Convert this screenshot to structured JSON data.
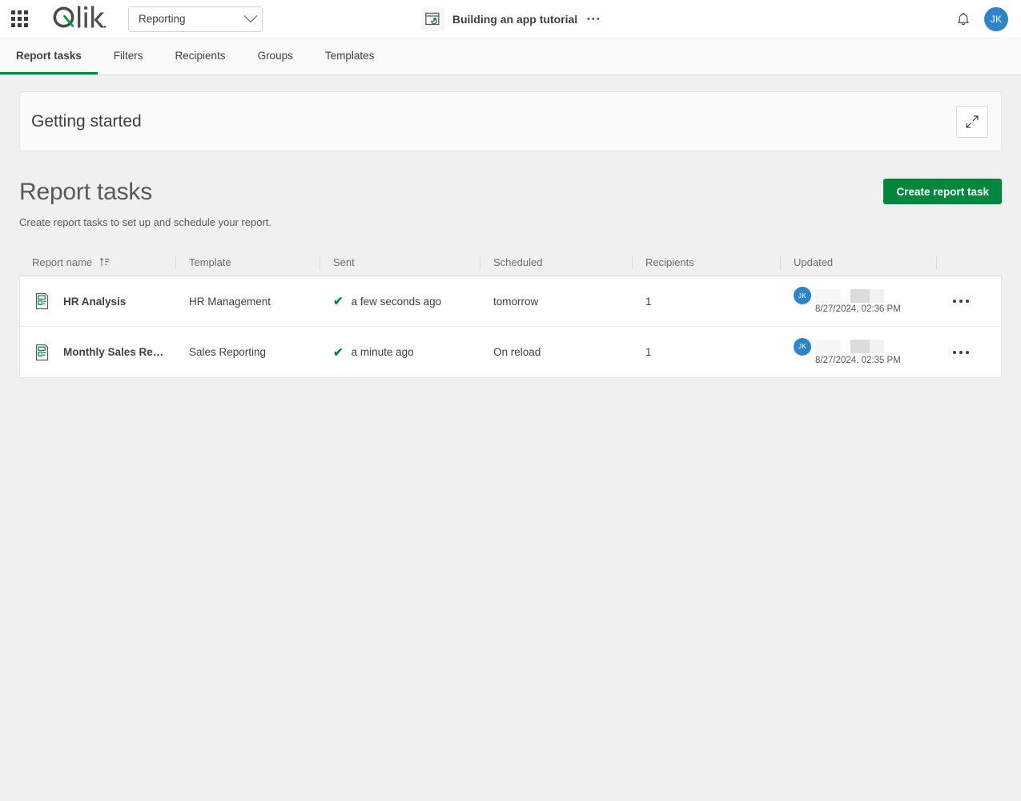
{
  "topbar": {
    "waffle_label": "App launcher",
    "logo_text": "Qlik",
    "space_selector": {
      "value": "Reporting",
      "icon": "chevron-down-icon"
    },
    "app": {
      "icon": "app-sheet-icon",
      "title": "Building an app tutorial",
      "more_icon": "ellipsis-horizontal-icon"
    },
    "notifications_icon": "bell-icon",
    "user_avatar": "JK"
  },
  "tabs": [
    {
      "label": "Report tasks",
      "active": true
    },
    {
      "label": "Filters",
      "active": false
    },
    {
      "label": "Recipients",
      "active": false
    },
    {
      "label": "Groups",
      "active": false
    },
    {
      "label": "Templates",
      "active": false
    }
  ],
  "getting_started": {
    "title": "Getting started",
    "expand_icon": "expand-diagonal-icon"
  },
  "page": {
    "title": "Report tasks",
    "subtitle": "Create report tasks to set up and schedule your report.",
    "create_button": "Create report task"
  },
  "table": {
    "columns": [
      {
        "label": "Report name",
        "sort_icon": "sort-ascending-icon"
      },
      {
        "label": "Template"
      },
      {
        "label": "Sent"
      },
      {
        "label": "Scheduled"
      },
      {
        "label": "Recipients"
      },
      {
        "label": "Updated"
      },
      {
        "label": ""
      }
    ],
    "rows": [
      {
        "icon": "report-document-icon",
        "name": "HR Analysis",
        "template": "HR Management",
        "sent_status_icon": "check-icon",
        "sent": "a few seconds ago",
        "scheduled": "tomorrow",
        "recipients": "1",
        "updated_by_initials": "JK",
        "updated_at": "8/27/2024, 02:36 PM",
        "actions_icon": "ellipsis-horizontal-icon"
      },
      {
        "icon": "report-document-icon",
        "name": "Monthly Sales Rep…",
        "template": "Sales Reporting",
        "sent_status_icon": "check-icon",
        "sent": "a minute ago",
        "scheduled": "On reload",
        "recipients": "1",
        "updated_by_initials": "JK",
        "updated_at": "8/27/2024, 02:35 PM",
        "actions_icon": "ellipsis-horizontal-icon"
      }
    ]
  },
  "colors": {
    "brand_green": "#00873d",
    "accent_blue": "#2e84c6",
    "check_green": "#008936",
    "page_bg": "#f0f0f0"
  }
}
